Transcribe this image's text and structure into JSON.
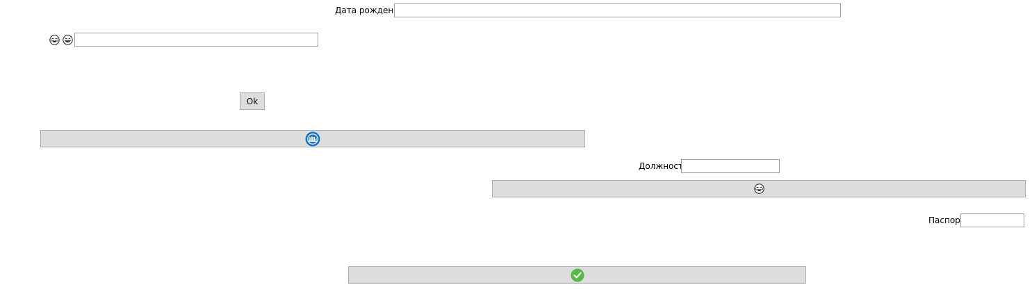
{
  "birth_date": {
    "label": "Дата рождения",
    "value": ""
  },
  "emoji_row": {
    "icons": [
      "laughing-face-icon",
      "grinning-face-icon"
    ],
    "value": ""
  },
  "ok_button": {
    "label": "Ok"
  },
  "wide_button_1": {
    "icon": "blue-badge-icon"
  },
  "position": {
    "label": "Должность",
    "value": ""
  },
  "wide_button_2": {
    "icon": "laughing-face-icon"
  },
  "passport": {
    "label": "Паспорт",
    "value": ""
  },
  "wide_button_3": {
    "icon": "green-checkmark-icon"
  },
  "colors": {
    "button_bg": "#dddddd",
    "button_border": "#adadad",
    "field_border": "#a0a0a0",
    "badge_blue": "#1a74c6",
    "check_green": "#55b948"
  }
}
